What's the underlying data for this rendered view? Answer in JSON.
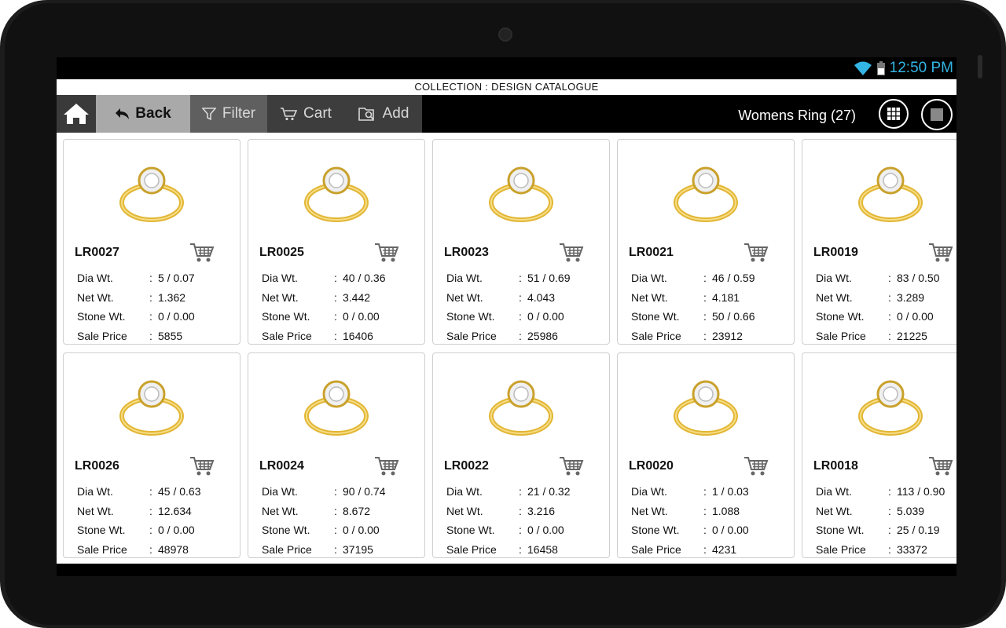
{
  "status": {
    "time": "12:50 PM"
  },
  "header": {
    "collection_title": "COLLECTION : DESIGN CATALOGUE"
  },
  "toolbar": {
    "back_label": "Back",
    "filter_label": "Filter",
    "cart_label": "Cart",
    "add_label": "Add",
    "title": "Womens Ring (27)"
  },
  "labels": {
    "dia_wt": "Dia Wt.",
    "net_wt": "Net Wt.",
    "stone_wt": "Stone Wt.",
    "sale_price": "Sale Price",
    "colon": ":"
  },
  "products": [
    {
      "code": "LR0027",
      "dia_wt": "5 / 0.07",
      "net_wt": "1.362",
      "stone_wt": "0 / 0.00",
      "sale_price": "5855"
    },
    {
      "code": "LR0025",
      "dia_wt": "40 / 0.36",
      "net_wt": "3.442",
      "stone_wt": "0 / 0.00",
      "sale_price": "16406"
    },
    {
      "code": "LR0023",
      "dia_wt": "51 / 0.69",
      "net_wt": "4.043",
      "stone_wt": "0 / 0.00",
      "sale_price": "25986"
    },
    {
      "code": "LR0021",
      "dia_wt": "46 / 0.59",
      "net_wt": "4.181",
      "stone_wt": "50 / 0.66",
      "sale_price": "23912"
    },
    {
      "code": "LR0019",
      "dia_wt": "83 / 0.50",
      "net_wt": "3.289",
      "stone_wt": "0 / 0.00",
      "sale_price": "21225"
    },
    {
      "code": "LR0026",
      "dia_wt": "45 / 0.63",
      "net_wt": "12.634",
      "stone_wt": "0 / 0.00",
      "sale_price": "48978"
    },
    {
      "code": "LR0024",
      "dia_wt": "90 / 0.74",
      "net_wt": "8.672",
      "stone_wt": "0 / 0.00",
      "sale_price": "37195"
    },
    {
      "code": "LR0022",
      "dia_wt": "21 / 0.32",
      "net_wt": "3.216",
      "stone_wt": "0 / 0.00",
      "sale_price": "16458"
    },
    {
      "code": "LR0020",
      "dia_wt": "1 / 0.03",
      "net_wt": "1.088",
      "stone_wt": "0 / 0.00",
      "sale_price": "4231"
    },
    {
      "code": "LR0018",
      "dia_wt": "113 / 0.90",
      "net_wt": "5.039",
      "stone_wt": "25 / 0.19",
      "sale_price": "33372"
    }
  ],
  "colors": {
    "accent": "#33b5e5",
    "gold": "#e2b635",
    "toolbar_bg": "#000000"
  },
  "icons": {
    "home": "home-icon",
    "back": "back-arrow-icon",
    "filter": "filter-icon",
    "cart": "cart-icon",
    "add": "add-search-icon",
    "grid": "grid-view-icon",
    "single": "single-view-icon"
  }
}
